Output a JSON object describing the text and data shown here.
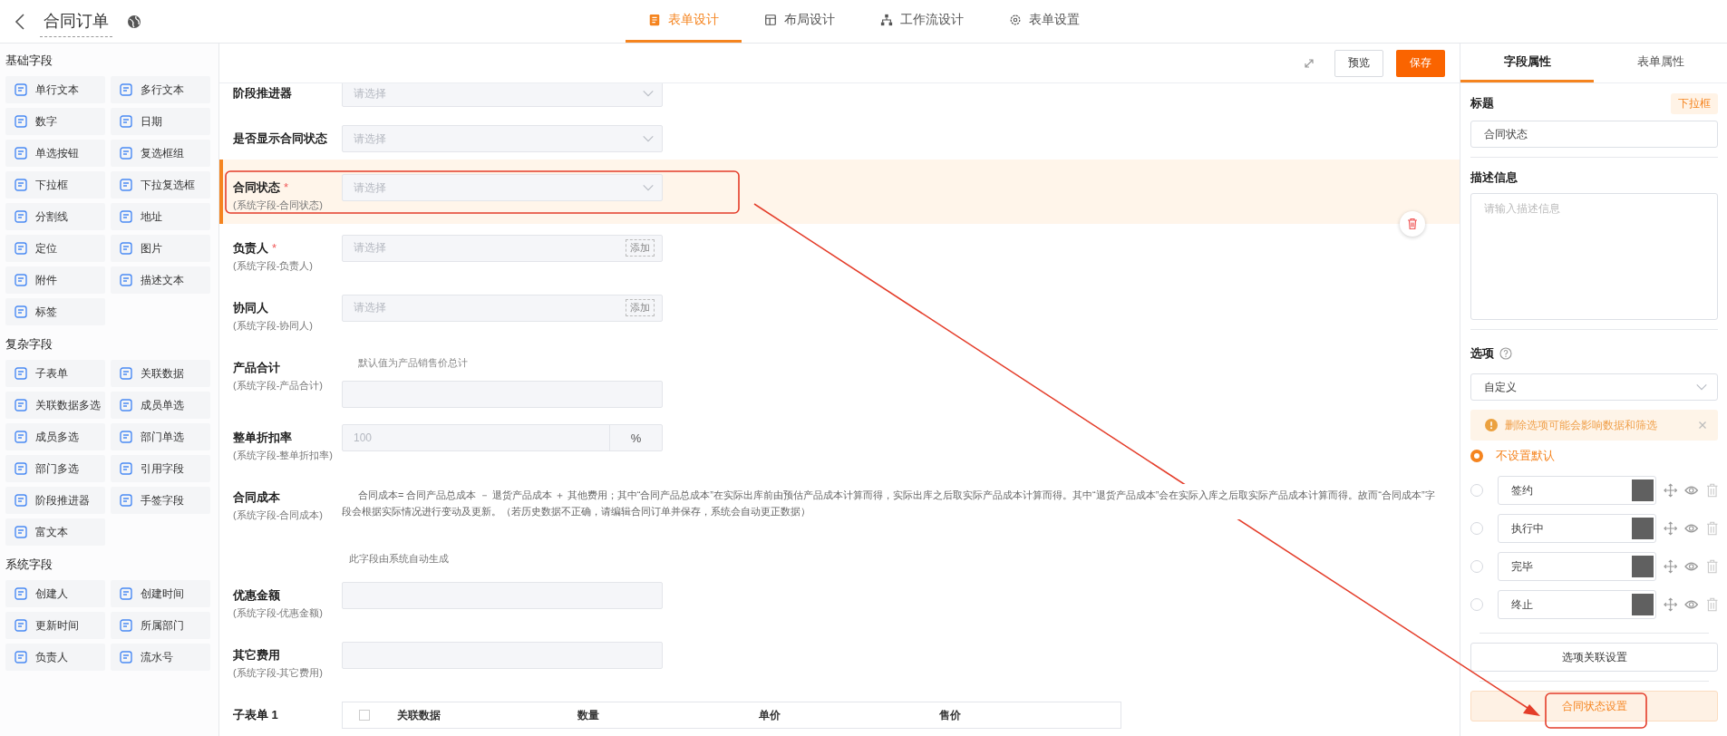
{
  "header": {
    "title": "合同订单",
    "tabs": [
      {
        "label": "表单设计",
        "kind": "form",
        "selected": true
      },
      {
        "label": "布局设计",
        "kind": "layout",
        "selected": false
      },
      {
        "label": "工作流设计",
        "kind": "flow",
        "selected": false
      },
      {
        "label": "表单设置",
        "kind": "settings",
        "selected": false
      }
    ]
  },
  "sidebar": {
    "groups": [
      {
        "title": "基础字段",
        "items": [
          {
            "label": "单行文本"
          },
          {
            "label": "多行文本"
          },
          {
            "label": "数字"
          },
          {
            "label": "日期"
          },
          {
            "label": "单选按钮"
          },
          {
            "label": "复选框组"
          },
          {
            "label": "下拉框"
          },
          {
            "label": "下拉复选框"
          },
          {
            "label": "分割线"
          },
          {
            "label": "地址"
          },
          {
            "label": "定位"
          },
          {
            "label": "图片"
          },
          {
            "label": "附件"
          },
          {
            "label": "描述文本"
          },
          {
            "label": "标签"
          }
        ]
      },
      {
        "title": "复杂字段",
        "items": [
          {
            "label": "子表单"
          },
          {
            "label": "关联数据"
          },
          {
            "label": "关联数据多选"
          },
          {
            "label": "成员单选"
          },
          {
            "label": "成员多选"
          },
          {
            "label": "部门单选"
          },
          {
            "label": "部门多选"
          },
          {
            "label": "引用字段"
          },
          {
            "label": "阶段推进器"
          },
          {
            "label": "手签字段"
          },
          {
            "label": "富文本"
          }
        ]
      },
      {
        "title": "系统字段",
        "items": [
          {
            "label": "创建人"
          },
          {
            "label": "创建时间"
          },
          {
            "label": "更新时间"
          },
          {
            "label": "所属部门"
          },
          {
            "label": "负责人"
          },
          {
            "label": "流水号"
          }
        ]
      }
    ]
  },
  "toolbar": {
    "preview": "预览",
    "save": "保存"
  },
  "fields": [
    {
      "kind": "select",
      "label": "阶段推进器",
      "selected": false,
      "placeholder": "请选择"
    },
    {
      "kind": "select",
      "label": "是否显示合同状态",
      "selected": false,
      "placeholder": "请选择"
    },
    {
      "kind": "select",
      "label": "合同状态",
      "required_mark": "*",
      "selected": true,
      "sublabel": "(系统字段-合同状态)",
      "placeholder": "请选择"
    },
    {
      "kind": "member",
      "label": "负责人",
      "required_mark": "*",
      "selected": false,
      "sublabel": "(系统字段-负责人)",
      "placeholder": "请选择",
      "add": "添加"
    },
    {
      "kind": "member",
      "label": "协同人",
      "selected": false,
      "sublabel": "(系统字段-协同人)",
      "placeholder": "请选择",
      "add": "添加"
    },
    {
      "kind": "number",
      "label": "产品合计",
      "selected": false,
      "sublabel": "(系统字段-产品合计)",
      "hint": "默认值为产品销售价总计"
    },
    {
      "kind": "percent",
      "label": "整单折扣率",
      "selected": false,
      "sublabel": "(系统字段-整单折扣率)",
      "placeholder": "100",
      "unit": "%"
    },
    {
      "kind": "note",
      "label": "合同成本",
      "selected": false,
      "sublabel": "(系统字段-合同成本)",
      "text": "合同成本= 合同产品总成本 － 退货产品成本 ＋ 其他费用；其中“合同产品总成本”在实际出库前由预估产品成本计算而得，实际出库之后取实际产品成本计算而得。其中“退货产品成本”会在实际入库之后取实际产品成本计算而得。故而“合同成本”字段会根据实际情况进行变动及更新。（若历史数据不正确，请编辑合同订单并保存，系统会自动更正数据）",
      "note": "此字段由系统自动生成"
    },
    {
      "kind": "number",
      "label": "优惠金额",
      "selected": false,
      "sublabel": "(系统字段-优惠金额)"
    },
    {
      "kind": "number",
      "label": "其它费用",
      "selected": false,
      "sublabel": "(系统字段-其它费用)"
    },
    {
      "kind": "subform",
      "label": "子表单 1",
      "selected": false,
      "columns": [
        "关联数据",
        "数量",
        "单价",
        "售价"
      ]
    }
  ],
  "panel": {
    "tabs": [
      {
        "label": "字段属性",
        "selected": true
      },
      {
        "label": "表单属性",
        "selected": false
      }
    ],
    "title_label": "标题",
    "type_tag": "下拉框",
    "title_value": "合同状态",
    "desc_label": "描述信息",
    "desc_placeholder": "请输入描述信息",
    "options_label": "选项",
    "source": "自定义",
    "alert": "删除选项可能会影响数据和筛选",
    "default_choice": {
      "label": "不设置默认",
      "selected": true
    },
    "options": [
      {
        "label": "签约",
        "color": "#606060",
        "selected": false
      },
      {
        "label": "执行中",
        "color": "#606060",
        "selected": false
      },
      {
        "label": "完毕",
        "color": "#606060",
        "selected": false
      },
      {
        "label": "终止",
        "color": "#606060",
        "selected": false
      }
    ],
    "link_button": "选项关联设置",
    "status_button": "合同状态设置"
  }
}
